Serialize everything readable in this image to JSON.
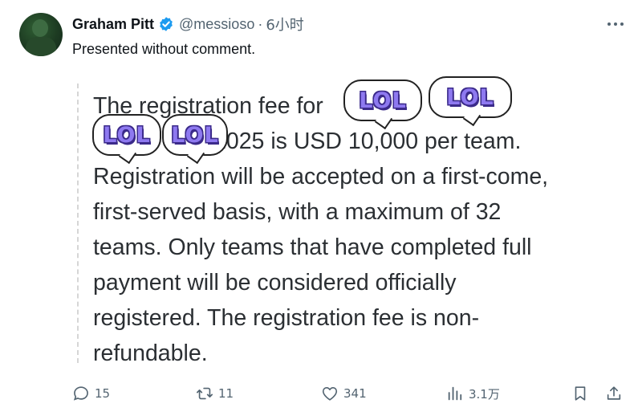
{
  "author": {
    "display_name": "Graham Pitt",
    "handle": "@messioso",
    "separator": "·",
    "time": "6小时",
    "verified": true
  },
  "tweet": {
    "text": "Presented without comment."
  },
  "quoted_image": {
    "lines": [
      "The registration fee for",
      "2025 is USD 10,000 per team.",
      "Registration will be accepted on a first-come,",
      "first-served basis, with a maximum of 32",
      "teams. Only teams that have completed full",
      "payment will be considered officially",
      "registered. The registration fee is non-",
      "refundable."
    ],
    "stickers": [
      "LOL",
      "LOL",
      "LOL",
      "LOL"
    ],
    "sticker_color": "#8e79f0"
  },
  "actions": {
    "replies": "15",
    "retweets": "11",
    "likes": "341",
    "views": "3.1万"
  },
  "icons": {
    "verified": "verified-badge-icon",
    "more": "more-dots-icon",
    "reply": "reply-icon",
    "retweet": "retweet-icon",
    "like": "heart-icon",
    "views": "views-chart-icon",
    "bookmark": "bookmark-icon",
    "share": "share-icon"
  },
  "colors": {
    "text": "#0f1419",
    "muted": "#536471",
    "verified": "#1d9bf0"
  }
}
